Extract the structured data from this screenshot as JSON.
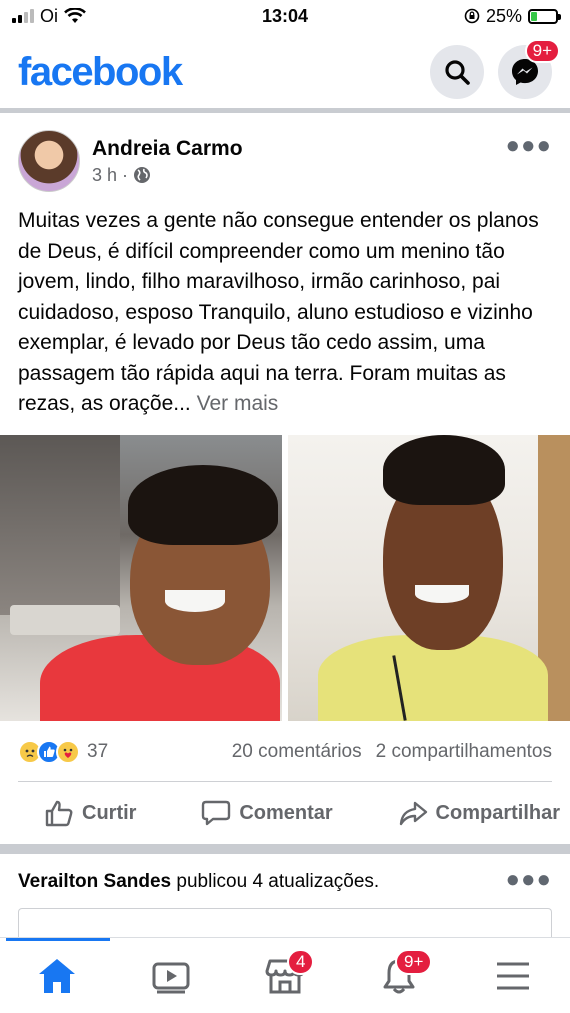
{
  "status_bar": {
    "carrier": "Oi",
    "time": "13:04",
    "battery_percent": "25%",
    "battery_level": 0.25
  },
  "header": {
    "logo": "facebook",
    "messenger_badge": "9+"
  },
  "post": {
    "author": "Andreia Carmo",
    "time": "3 h ·",
    "privacy_icon": "globe-icon",
    "text": "Muitas vezes a gente não consegue entender os planos de Deus, é difícil compreender como um menino tão jovem, lindo, filho maravilhoso, irmão carinhoso, pai cuidadoso, esposo Tranquilo, aluno estudioso e vizinho exemplar, é levado por Deus tão cedo assim, uma passagem tão rápida aqui na terra. Foram muitas as rezas, as oraçõe...",
    "see_more": "Ver mais",
    "reaction_count": "37",
    "comments": "20 comentários",
    "shares": "2 compartilhamentos",
    "actions": {
      "like": "Curtir",
      "comment": "Comentar",
      "share": "Compartilhar"
    }
  },
  "next_post": {
    "author": "Verailton Sandes",
    "text": " publicou 4 atualizações."
  },
  "bottom_nav": {
    "marketplace_badge": "4",
    "notifications_badge": "9+"
  },
  "colors": {
    "brand": "#1877f2",
    "badge": "#e41e3f",
    "secondary_text": "#65676b"
  }
}
